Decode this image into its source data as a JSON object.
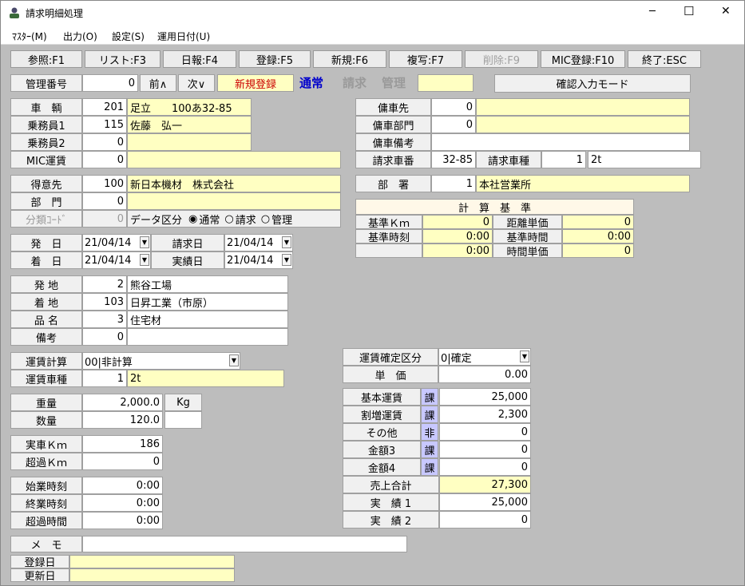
{
  "window": {
    "title": "請求明細処理",
    "minimize": "─",
    "maximize": "☐",
    "close": "✕"
  },
  "menu": [
    "ﾏｽﾀｰ(M)",
    "出力(O)",
    "設定(S)",
    "運用日付(U)"
  ],
  "toolbar": [
    "参照:F1",
    "リスト:F3",
    "日報:F4",
    "登録:F5",
    "新規:F6",
    "複写:F7",
    "削除:F9",
    "MIC登録:F10",
    "終了:ESC"
  ],
  "header": {
    "kanri_label": "管理番号",
    "kanri_value": "0",
    "prev": "前∧",
    "next": "次∨",
    "status": "新規登録",
    "mode_normal": "通常",
    "mode_seikyu": "請求",
    "mode_kanri": "管理",
    "confirm": "確認入力モード"
  },
  "vehicle": {
    "sharyo_label": "車　輌",
    "sharyo_code": "201",
    "sharyo_name": "足立　　100あ32-85",
    "jomuin1_label": "乗務員1",
    "jomuin1_code": "115",
    "jomuin1_name": "佐藤　弘一",
    "jomuin2_label": "乗務員2",
    "jomuin2_code": "0",
    "jomuin2_name": "",
    "mic_label": "MIC運賃",
    "mic_code": "0",
    "mic_name": ""
  },
  "charter": {
    "yosha_label": "傭車先",
    "yosha_code": "0",
    "yosha_name": "",
    "yosha_bumon_label": "傭車部門",
    "yosha_bumon_code": "0",
    "yosha_bumon_name": "",
    "yosha_biko_label": "傭車備考",
    "yosha_biko_value": "",
    "seikyu_shaban_label": "請求車番",
    "seikyu_shaban_value": "32-85",
    "seikyu_shashu_label": "請求車種",
    "seikyu_shashu_code": "1",
    "seikyu_shashu_name": "2t"
  },
  "customer": {
    "tokui_label": "得意先",
    "tokui_code": "100",
    "tokui_name": "新日本機材　株式会社",
    "bumon_label": "部　門",
    "bumon_code": "0",
    "bumon_name": "",
    "bunrui_label": "分類ｺｰﾄﾞ",
    "bunrui_code": "0",
    "data_kubun_label": "データ区分",
    "radio_normal": "通常",
    "radio_seikyu": "請求",
    "radio_kanri": "管理"
  },
  "busho": {
    "label": "部　署",
    "code": "1",
    "name": "本社営業所"
  },
  "calc": {
    "title": "計　算　基　準",
    "kijun_km_label": "基準Ｋｍ",
    "kijun_km": "0",
    "kyori_tanka_label": "距離単価",
    "kyori_tanka": "0",
    "kijun_jikoku_label": "基準時刻",
    "kijun_jikoku": "0:00",
    "kijun_jikan_label": "基準時間",
    "kijun_jikan": "0:00",
    "row3_value": "0:00",
    "jikan_tanka_label": "時間単価",
    "jikan_tanka": "0"
  },
  "dates": {
    "hatsu_label": "発　日",
    "hatsu": "21/04/14",
    "chaku_label": "着　日",
    "chaku": "21/04/14",
    "seikyu_label": "請求日",
    "seikyu": "21/04/14",
    "jisseki_label": "実績日",
    "jisseki": "21/04/14"
  },
  "places": {
    "hatchi_label": "発 地",
    "hatchi_code": "2",
    "hatchi_name": "熊谷工場",
    "chakuchi_label": "着 地",
    "chakuchi_code": "103",
    "chakuchi_name": "日昇工業（市原）",
    "hinmei_label": "品 名",
    "hinmei_code": "3",
    "hinmei_name": "住宅材",
    "biko_label": "備考",
    "biko_code": "0",
    "biko_name": ""
  },
  "fare": {
    "keisan_label": "運賃計算",
    "keisan_value": "00|非計算",
    "shashu_label": "運賃車種",
    "shashu_code": "1",
    "shashu_name": "2t",
    "kakutei_label": "運賃確定区分",
    "kakutei_value": "0|確定",
    "tanka_label": "単　価",
    "tanka": "0.00"
  },
  "weight": {
    "juryo_label": "重量",
    "juryo": "2,000.0",
    "unit": "Kg",
    "suryo_label": "数量",
    "suryo": "120.0",
    "suryo_unit": ""
  },
  "km": {
    "jissha_label": "実車Ｋｍ",
    "jissha": "186",
    "choka_label": "超過Ｋｍ",
    "choka": "0"
  },
  "time": {
    "shigyo_label": "始業時刻",
    "shigyo": "0:00",
    "shugyo_label": "終業時刻",
    "shugyo": "0:00",
    "choka_label": "超過時間",
    "choka": "0:00"
  },
  "amounts": {
    "kihon_label": "基本運賃",
    "kihon_tax": "課",
    "kihon": "25,000",
    "warimashi_label": "割増運賃",
    "warimashi_tax": "課",
    "warimashi": "2,300",
    "sonota_label": "その他",
    "sonota_tax": "非",
    "sonota": "0",
    "kingaku3_label": "金額3",
    "kingaku3_tax": "課",
    "kingaku3": "0",
    "kingaku4_label": "金額4",
    "kingaku4_tax": "課",
    "kingaku4": "0",
    "uriage_label": "売上合計",
    "uriage": "27,300",
    "jisseki1_label": "実　績 1",
    "jisseki1": "25,000",
    "jisseki2_label": "実　績 2",
    "jisseki2": "0"
  },
  "memo": {
    "label": "メ　モ",
    "value": "",
    "toroku_label": "登録日",
    "toroku": "",
    "koshin_label": "更新日",
    "koshin": ""
  },
  "colors": {
    "yellow": "#ffffc2",
    "tax": "#c8c8ff",
    "status_red": "#cc0000",
    "mode_blue": "#0000cc"
  }
}
